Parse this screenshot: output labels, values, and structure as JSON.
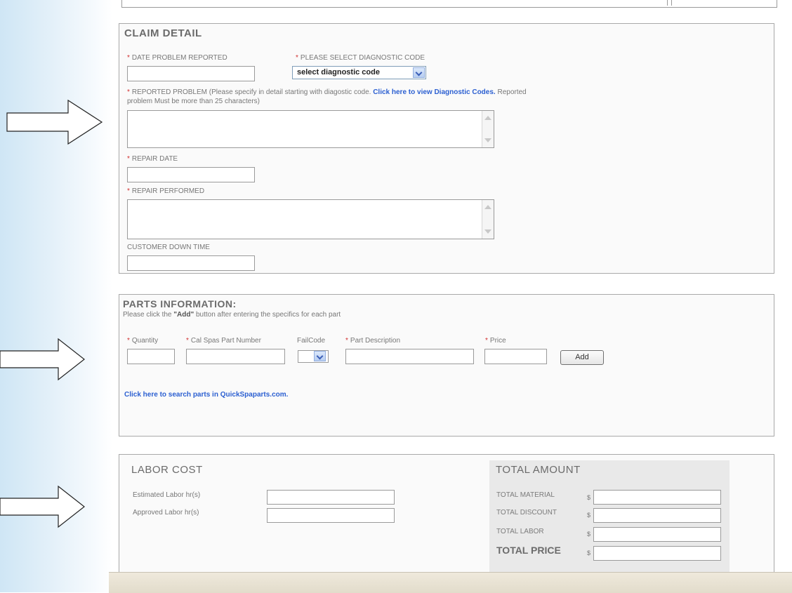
{
  "claim_detail": {
    "title": "CLAIM DETAIL",
    "date_problem_reported_label": "DATE PROBLEM REPORTED",
    "diagnostic_code_label": "PLEASE SELECT DIAGNOSTIC CODE",
    "diagnostic_code_value": "select diagnostic code",
    "reported_problem_label": "REPORTED PROBLEM (Please specify in detail starting with diagostic code.",
    "reported_problem_link": "Click here to view Diagnostic Codes.",
    "reported_problem_note_a": "Reported",
    "reported_problem_note_b": "problem Must be more than 25 characters)",
    "repair_date_label": "REPAIR DATE",
    "repair_performed_label": "REPAIR PERFORMED",
    "customer_down_time_label": "CUSTOMER DOWN TIME"
  },
  "parts": {
    "title": "PARTS INFORMATION:",
    "instruction_a": "Please click the",
    "instruction_add": "\"Add\"",
    "instruction_b": "button after entering the specifics for each part",
    "col_quantity": "Quantity",
    "col_part_number": "Cal Spas Part Number",
    "col_failcode": "FailCode",
    "col_description": "Part Description",
    "col_price": "Price",
    "add_button": "Add",
    "search_link": "Click here to search parts in QuickSpaparts.com."
  },
  "labor": {
    "title": "LABOR COST",
    "estimated_label": "Estimated Labor hr(s)",
    "approved_label": "Approved Labor hr(s)"
  },
  "totals": {
    "title": "TOTAL AMOUNT",
    "material_label": "TOTAL MATERIAL",
    "discount_label": "TOTAL DISCOUNT",
    "labor_label": "TOTAL LABOR",
    "price_label": "TOTAL PRICE",
    "currency": "$"
  },
  "colors": {
    "required_marker": "#d23030",
    "link": "#2b5fd1"
  }
}
